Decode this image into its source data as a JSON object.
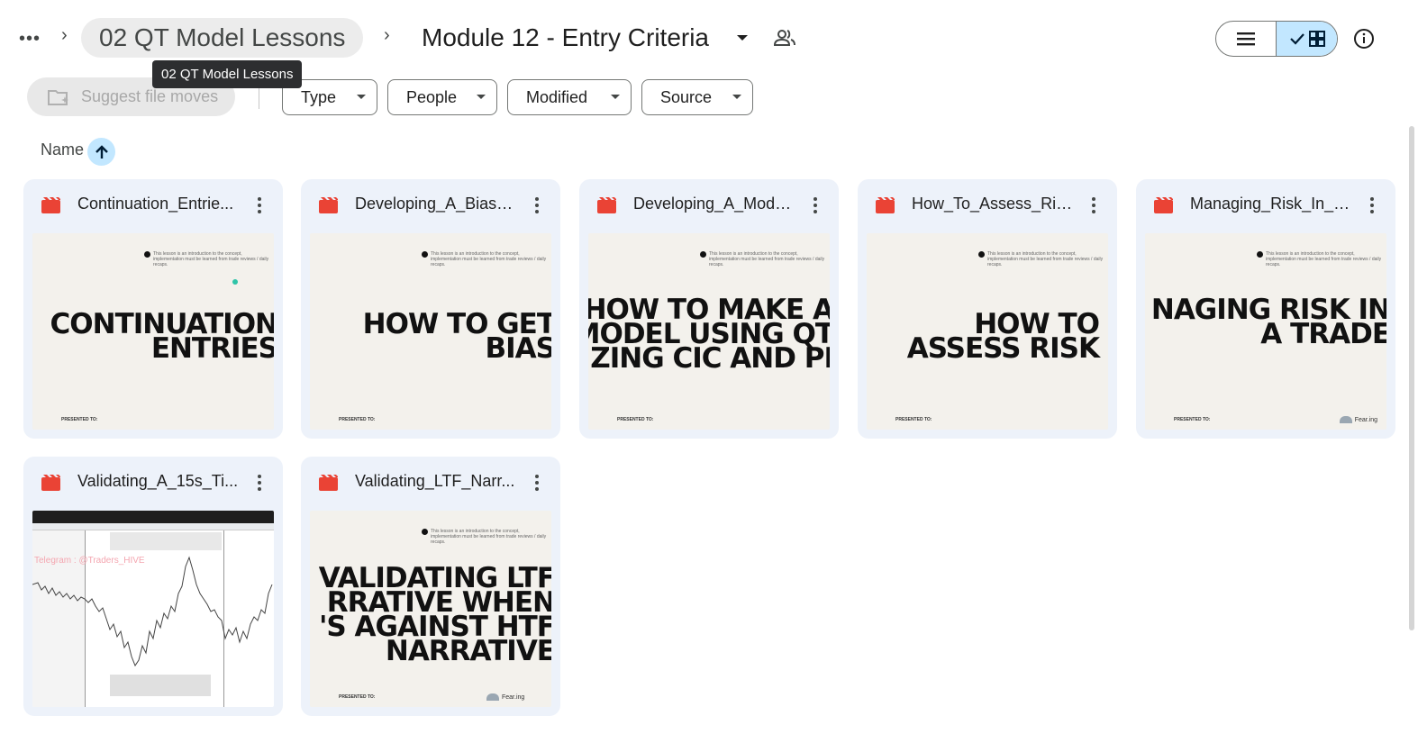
{
  "breadcrumb": {
    "more_label": "•••",
    "parent": "02 QT Model Lessons",
    "current": "Module 12 - Entry Criteria",
    "tooltip": "02 QT Model Lessons"
  },
  "toolbar": {
    "suggest_label": "Suggest file moves",
    "filters": [
      "Type",
      "People",
      "Modified",
      "Source"
    ]
  },
  "sort": {
    "label": "Name",
    "direction": "ascending"
  },
  "view": {
    "active": "grid"
  },
  "files": [
    {
      "name": "Continuation_Entrie...",
      "thumb_title": "CONTINUATION\nENTRIES",
      "presented": "PRESENTED TO:",
      "note": "This lesson is an introduction to the concept, implementation must be learned from trade reviews / daily recaps."
    },
    {
      "name": "Developing_A_Bias_...",
      "thumb_title": "HOW TO GET\nBIAS",
      "presented": "PRESENTED TO:",
      "note": "This lesson is an introduction to the concept, implementation must be learned from trade reviews / daily recaps."
    },
    {
      "name": "Developing_A_Mode...",
      "thumb_title": "HOW TO MAKE A\nMODEL USING QT\nZING CIC AND PI",
      "presented": "PRESENTED TO:",
      "note": "This lesson is an introduction to the concept, implementation must be learned from trade reviews / daily recaps."
    },
    {
      "name": "How_To_Assess_Ris...",
      "thumb_title": "HOW TO\nASSESS RISK",
      "presented": "PRESENTED TO:",
      "note": "This lesson is an introduction to the concept, implementation must be learned from trade reviews / daily recaps."
    },
    {
      "name": "Managing_Risk_In_A...",
      "thumb_title": "NAGING RISK IN\nA TRADE",
      "presented": "PRESENTED TO:",
      "note": "This lesson is an introduction to the concept, implementation must be learned from trade reviews / daily recaps.",
      "logo": "Fear.ing"
    },
    {
      "name": "Validating_A_15s_Ti...",
      "thumb_type": "chart",
      "watermark": "Telegram : @Traders_HIVE"
    },
    {
      "name": "Validating_LTF_Narr...",
      "thumb_title": "VALIDATING LTF\nRRATIVE WHEN\n'S AGAINST HTF\nNARRATIVE",
      "presented": "PRESENTED TO:",
      "note": "This lesson is an introduction to the concept, implementation must be learned from trade reviews / daily recaps.",
      "logo": "Fear.ing"
    }
  ],
  "colors": {
    "card_bg": "#edf2fa",
    "accent_light": "#c2e7ff",
    "video_red": "#ea4335"
  }
}
